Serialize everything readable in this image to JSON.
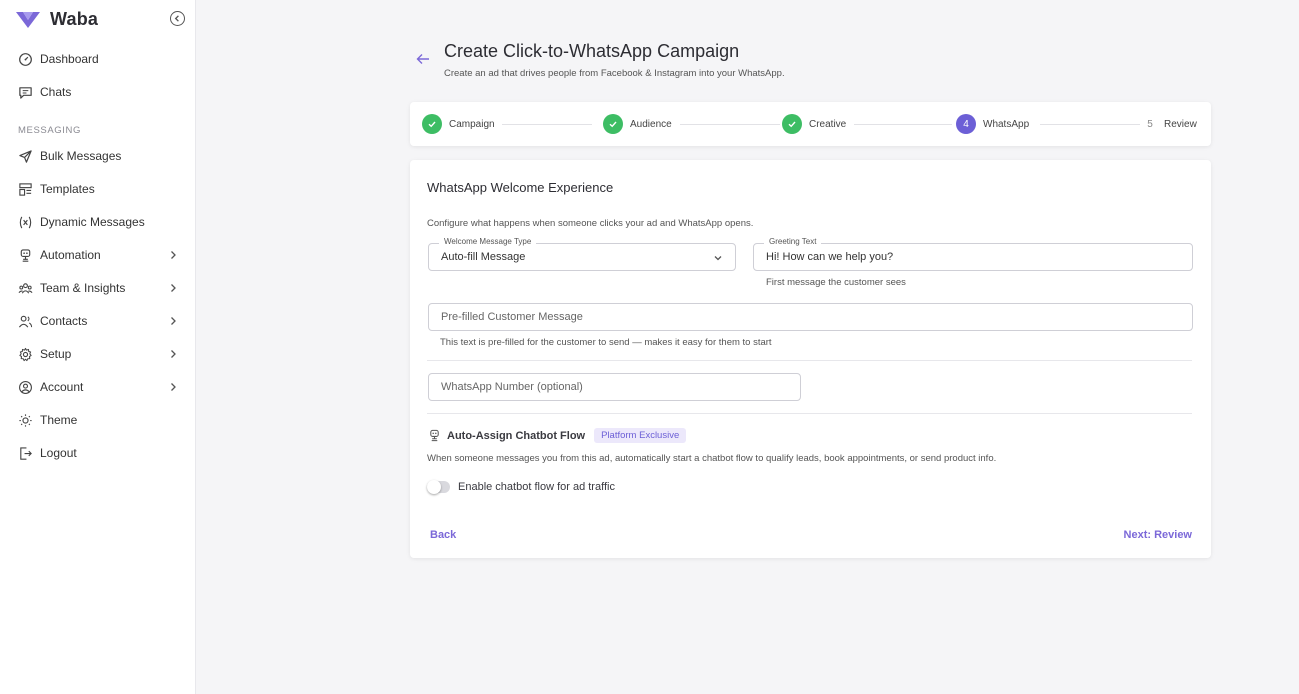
{
  "app": {
    "name": "Waba",
    "accent": "#7b68d8",
    "success": "#3dbd64"
  },
  "sidebar": {
    "items_top": [
      {
        "label": "Dashboard",
        "icon": "dashboard-icon"
      },
      {
        "label": "Chats",
        "icon": "chat-icon"
      }
    ],
    "section_label": "MESSAGING",
    "items": [
      {
        "label": "Bulk Messages",
        "icon": "send-icon"
      },
      {
        "label": "Templates",
        "icon": "templates-icon"
      },
      {
        "label": "Dynamic Messages",
        "icon": "variable-icon"
      },
      {
        "label": "Automation",
        "icon": "automation-icon",
        "has_children": true
      },
      {
        "label": "Team & Insights",
        "icon": "team-icon",
        "has_children": true
      },
      {
        "label": "Contacts",
        "icon": "contacts-icon",
        "has_children": true
      },
      {
        "label": "Setup",
        "icon": "gear-icon",
        "has_children": true
      },
      {
        "label": "Account",
        "icon": "account-icon",
        "has_children": true
      },
      {
        "label": "Theme",
        "icon": "sun-icon"
      },
      {
        "label": "Logout",
        "icon": "logout-icon"
      }
    ]
  },
  "header": {
    "title": "Create Click-to-WhatsApp Campaign",
    "subtitle": "Create an ad that drives people from Facebook & Instagram into your WhatsApp."
  },
  "stepper": {
    "steps": [
      {
        "label": "Campaign",
        "state": "done"
      },
      {
        "label": "Audience",
        "state": "done"
      },
      {
        "label": "Creative",
        "state": "done"
      },
      {
        "label": "WhatsApp",
        "state": "active",
        "number": "4"
      },
      {
        "label": "Review",
        "state": "pending",
        "number": "5"
      }
    ]
  },
  "form": {
    "title": "WhatsApp Welcome Experience",
    "description": "Configure what happens when someone clicks your ad and WhatsApp opens.",
    "welcome_type": {
      "label": "Welcome Message Type",
      "value": "Auto-fill Message"
    },
    "greeting": {
      "label": "Greeting Text",
      "value": "Hi! How can we help you?",
      "helper": "First message the customer sees"
    },
    "prefilled": {
      "placeholder": "Pre-filled Customer Message",
      "helper": "This text is pre-filled for the customer to send — makes it easy for them to start"
    },
    "number": {
      "placeholder": "WhatsApp Number (optional)"
    },
    "chatbot": {
      "title": "Auto-Assign Chatbot Flow",
      "badge": "Platform Exclusive",
      "description": "When someone messages you from this ad, automatically start a chatbot flow to qualify leads, book appointments, or send product info.",
      "toggle_label": "Enable chatbot flow for ad traffic",
      "toggle_on": false
    },
    "back_label": "Back",
    "next_label": "Next: Review"
  }
}
